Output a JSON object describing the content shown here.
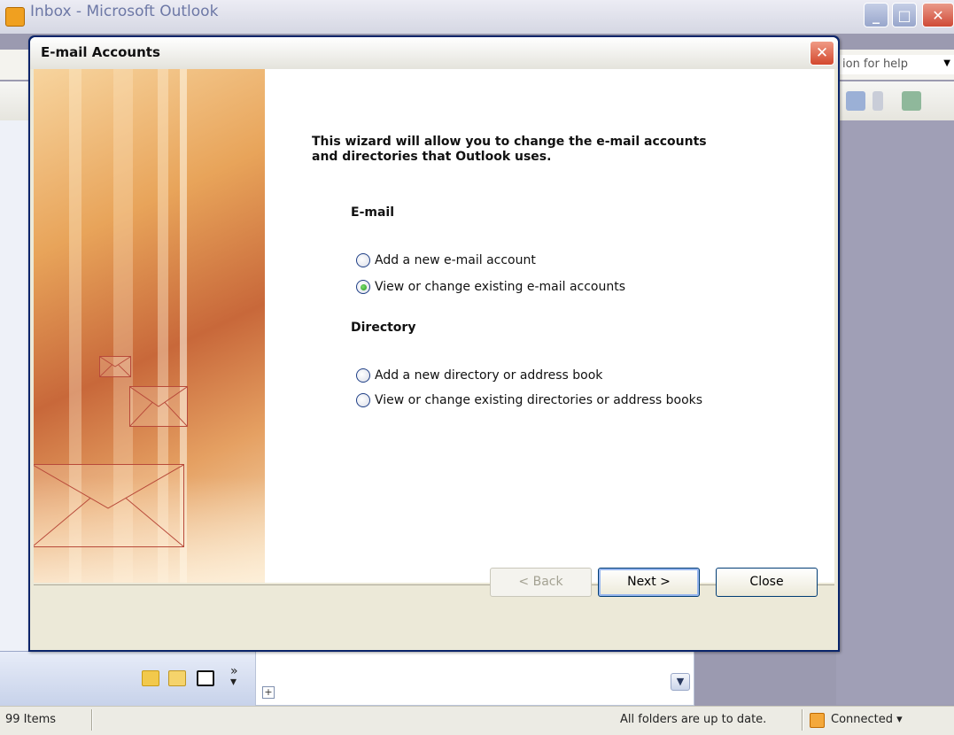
{
  "outlook": {
    "window_title": "Inbox - Microsoft Outlook",
    "help_box_text": "ion for help",
    "status": {
      "items_count": "99 Items",
      "sync_status": "All folders are up to date.",
      "connection": "Connected ▾"
    }
  },
  "dialog": {
    "title": "E-mail Accounts",
    "close_glyph": "✕",
    "heading": "This wizard will allow you to change the e-mail accounts and directories that Outlook uses.",
    "email_section": {
      "title": "E-mail",
      "options": [
        {
          "label": "Add a new e-mail account",
          "selected": false
        },
        {
          "label": "View or change existing e-mail accounts",
          "selected": true
        }
      ]
    },
    "directory_section": {
      "title": "Directory",
      "options": [
        {
          "label": "Add a new directory or address book",
          "selected": false
        },
        {
          "label": "View or change existing directories or address books",
          "selected": false
        }
      ]
    },
    "buttons": {
      "back": "< Back",
      "next": "Next >",
      "close": "Close"
    }
  },
  "colors": {
    "dialog_border": "#0a246a",
    "title_close": "#d3482e",
    "radio_selected": "#1f9a1f"
  }
}
